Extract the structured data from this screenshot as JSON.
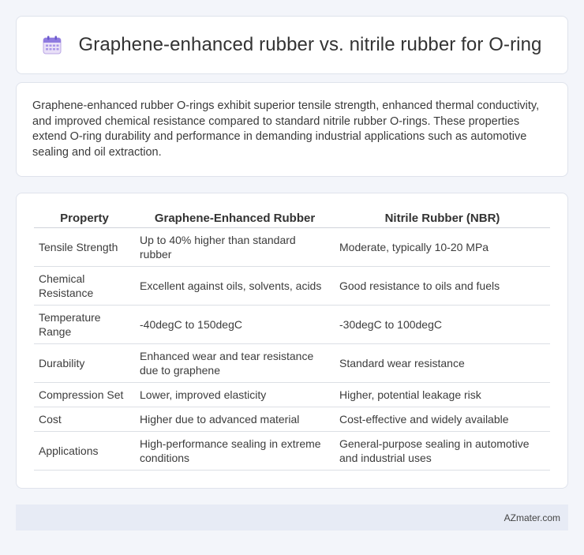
{
  "header": {
    "title": "Graphene-enhanced rubber vs. nitrile rubber for O-ring",
    "icon": "calendar-icon"
  },
  "description": "Graphene-enhanced rubber O-rings exhibit superior tensile strength, enhanced thermal conductivity, and improved chemical resistance compared to standard nitrile rubber O-rings. These properties extend O-ring durability and performance in demanding industrial applications such as automotive sealing and oil extraction.",
  "table": {
    "headers": [
      "Property",
      "Graphene-Enhanced Rubber",
      "Nitrile Rubber (NBR)"
    ],
    "rows": [
      [
        "Tensile Strength",
        "Up to 40% higher than standard rubber",
        "Moderate, typically 10-20 MPa"
      ],
      [
        "Chemical Resistance",
        "Excellent against oils, solvents, acids",
        "Good resistance to oils and fuels"
      ],
      [
        "Temperature Range",
        "-40degC to 150degC",
        "-30degC to 100degC"
      ],
      [
        "Durability",
        "Enhanced wear and tear resistance due to graphene",
        "Standard wear resistance"
      ],
      [
        "Compression Set",
        "Lower, improved elasticity",
        "Higher, potential leakage risk"
      ],
      [
        "Cost",
        "Higher due to advanced material",
        "Cost-effective and widely available"
      ],
      [
        "Applications",
        "High-performance sealing in extreme conditions",
        "General-purpose sealing in automotive and industrial uses"
      ]
    ]
  },
  "footer": {
    "brand": "AZmater.com"
  }
}
